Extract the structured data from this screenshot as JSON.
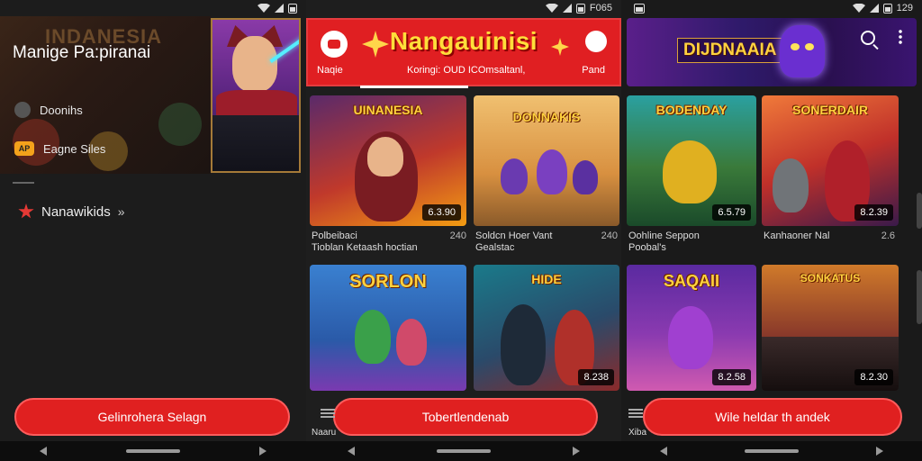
{
  "panel1": {
    "status": {
      "right_text": ""
    },
    "header_art_text": "INDANESIA",
    "title": "Manige Pa:piranai",
    "menu_rows": [
      {
        "icon": "user-avatar-icon",
        "label": "Doonihs"
      },
      {
        "icon": "ap-badge-icon",
        "badge": "AP",
        "label": "Eagne Siles"
      }
    ],
    "nav_item": {
      "label": "Nanawikids",
      "chevron": "»"
    },
    "cta": "Gelinrohera Selagn"
  },
  "panel2": {
    "status": {
      "right_text": "F065"
    },
    "banner": {
      "title": "Nangauinisi",
      "sub_left": "Naqie",
      "sub_center": "Koringi: OUD ICOmsaltanl,",
      "sub_right": "Pand"
    },
    "cards": [
      {
        "title": "UINANESIA",
        "price": "6.3.90",
        "meta_title": "Polbeibaci",
        "meta_sub": "Tioblan Ketaash hoctian",
        "meta_num": "240"
      },
      {
        "title": "DONNAKIS",
        "price": "",
        "meta_title": "Soldcn Hoer Vant",
        "meta_sub": "Gealstac",
        "meta_num": "240"
      },
      {
        "title": "SORLON",
        "price": "",
        "meta_title": "",
        "meta_sub": "",
        "meta_num": ""
      },
      {
        "title": "HIDE",
        "price": "8.238",
        "meta_title": "",
        "meta_sub": "",
        "meta_num": ""
      }
    ],
    "cta": "Tobertlendenab",
    "footer_label": "Naaru"
  },
  "panel3": {
    "status": {
      "left_text": "",
      "right_text": "129"
    },
    "banner": {
      "title": "DIJDNAAIA"
    },
    "cards": [
      {
        "title": "BODENDAY",
        "price": "6.5.79",
        "meta_title": "Oohline Seppon",
        "meta_sub": "Poobal's",
        "meta_num": ""
      },
      {
        "title": "SONERDAIR",
        "price": "8.2.39",
        "meta_title": "Kanhaoner Nal",
        "meta_sub": "",
        "meta_num": "2.6"
      },
      {
        "title": "SAQAII",
        "price": "8.2.58",
        "meta_title": "",
        "meta_sub": "",
        "meta_num": ""
      },
      {
        "title": "SONKATUS",
        "price": "8.2.30",
        "meta_title": "",
        "meta_sub": "",
        "meta_num": ""
      }
    ],
    "cta": "Wile heldar th andek",
    "footer_label": "Xiba"
  },
  "colors": {
    "accent": "#e02020",
    "banner_yellow": "#ffd23f",
    "background": "#1c1c1c"
  }
}
